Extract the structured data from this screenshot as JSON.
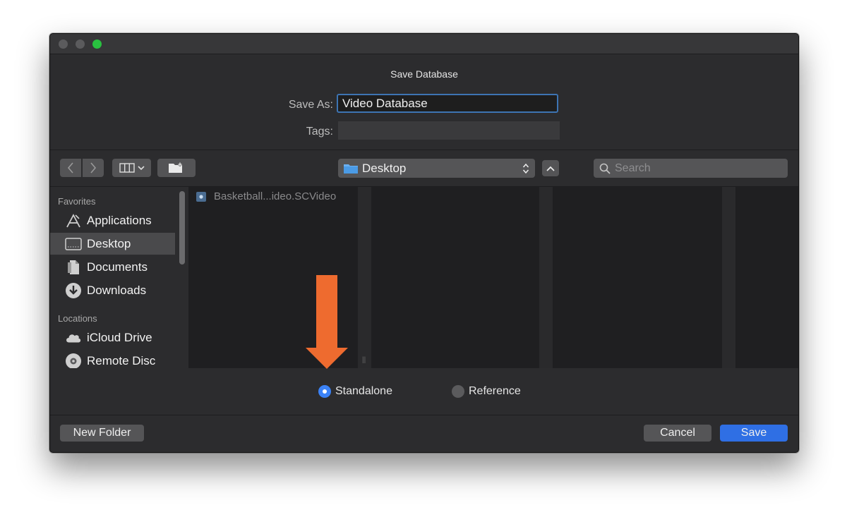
{
  "dialog": {
    "title": "Save Database",
    "save_as_label": "Save As:",
    "save_as_value": "Video Database",
    "tags_label": "Tags:",
    "tags_value": ""
  },
  "toolbar": {
    "location": "Desktop",
    "search_placeholder": "Search"
  },
  "sidebar": {
    "favorites_header": "Favorites",
    "favorites": [
      {
        "label": "Applications",
        "icon": "applications-icon"
      },
      {
        "label": "Desktop",
        "icon": "desktop-icon",
        "selected": true
      },
      {
        "label": "Documents",
        "icon": "documents-icon"
      },
      {
        "label": "Downloads",
        "icon": "downloads-icon"
      }
    ],
    "locations_header": "Locations",
    "locations": [
      {
        "label": "iCloud Drive",
        "icon": "cloud-icon"
      },
      {
        "label": "Remote Disc",
        "icon": "disc-icon"
      }
    ]
  },
  "files": [
    {
      "name": "Basketball...ideo.SCVideo",
      "icon": "video-file-icon"
    }
  ],
  "options": {
    "standalone_label": "Standalone",
    "reference_label": "Reference",
    "selected": "Standalone"
  },
  "footer": {
    "new_folder_label": "New Folder",
    "cancel_label": "Cancel",
    "save_label": "Save"
  },
  "colors": {
    "accent": "#3b82f6",
    "annotation_arrow": "#ee6b2f",
    "window_bg": "#2c2c2e"
  }
}
